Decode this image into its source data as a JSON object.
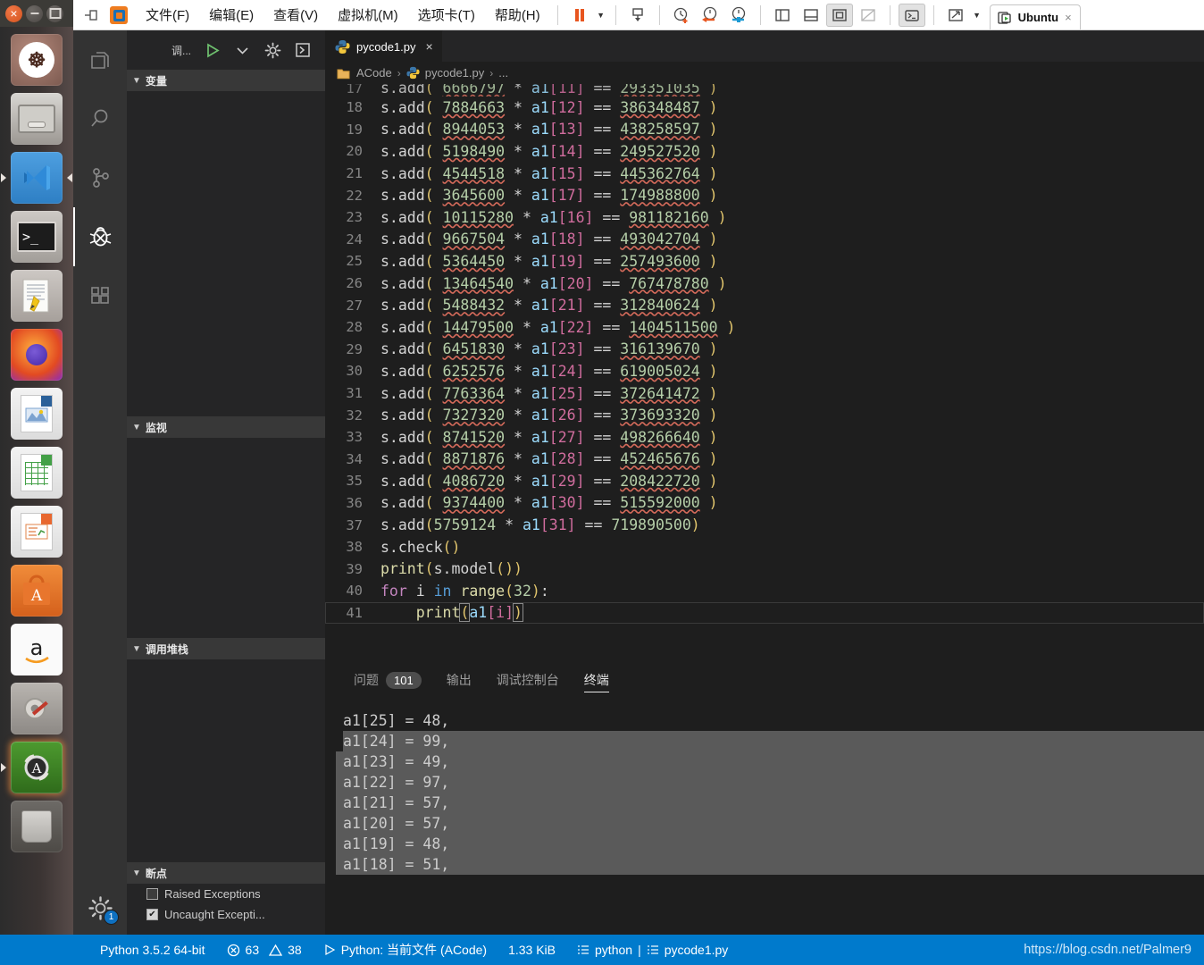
{
  "vmware": {
    "menus": [
      {
        "label": "文件(F)",
        "accel": "F"
      },
      {
        "label": "编辑(E)",
        "accel": "E"
      },
      {
        "label": "查看(V)",
        "accel": "V"
      },
      {
        "label": "虚拟机(M)",
        "accel": "M"
      },
      {
        "label": "选项卡(T)",
        "accel": "T"
      },
      {
        "label": "帮助(H)",
        "accel": "H"
      }
    ],
    "tab_label": "Ubuntu",
    "tab_close": "×",
    "toolbar_icons": [
      "unpin-icon",
      "vmware-logo-icon",
      "suspend-icon",
      "toolbar-dropdown-caret",
      "power-icon",
      "snapshot-take-icon",
      "snapshot-revert-icon",
      "snapshot-manager-icon",
      "sidebar-layout-icon",
      "bottom-layout-icon",
      "fullscreen-icon",
      "unity-mode-icon",
      "console-icon",
      "stretch-icon",
      "stretch-caret-icon"
    ]
  },
  "ubuntu": {
    "window_controls": [
      "close-button",
      "minimize-button",
      "maximize-button"
    ],
    "launcher": [
      {
        "name": "ubuntu-dash",
        "label": "Ubuntu",
        "glyph": "●"
      },
      {
        "name": "files",
        "label": "Files"
      },
      {
        "name": "vscode",
        "label": "Visual Studio Code"
      },
      {
        "name": "terminal",
        "label": "Terminal",
        "glyph": ">_"
      },
      {
        "name": "text-editor",
        "label": "Text Editor"
      },
      {
        "name": "firefox",
        "label": "Firefox"
      },
      {
        "name": "libreoffice-draw",
        "label": "LibreOffice Draw"
      },
      {
        "name": "libreoffice-calc",
        "label": "LibreOffice Calc"
      },
      {
        "name": "libreoffice-impress",
        "label": "LibreOffice Impress"
      },
      {
        "name": "ubuntu-software",
        "label": "Ubuntu Software",
        "glyph": "A"
      },
      {
        "name": "amazon",
        "label": "Amazon",
        "glyph": "a"
      },
      {
        "name": "system-settings",
        "label": "System Settings"
      },
      {
        "name": "software-updater",
        "label": "Software Updater",
        "glyph": "A"
      },
      {
        "name": "trash",
        "label": "Trash"
      }
    ]
  },
  "vscode": {
    "activitybar": [
      {
        "name": "explorer",
        "icon": "files-icon",
        "active": false
      },
      {
        "name": "search",
        "icon": "search-icon",
        "active": false
      },
      {
        "name": "source-control",
        "icon": "branch-icon",
        "active": false
      },
      {
        "name": "debug",
        "icon": "bug-icon",
        "active": true
      },
      {
        "name": "extensions",
        "icon": "extensions-icon",
        "active": false
      }
    ],
    "manage_badge": "1",
    "debug_toolbar": {
      "config_label": "调...",
      "start_icon": "play-icon",
      "dropdown_icon": "chevron-down-icon",
      "gear_icon": "gear-icon",
      "console_icon": "open-debug-console-icon"
    },
    "sidebar_sections": [
      {
        "title": "变量"
      },
      {
        "title": "监视"
      },
      {
        "title": "调用堆栈"
      },
      {
        "title": "断点"
      }
    ],
    "breakpoints": [
      {
        "label": "Raised Exceptions",
        "checked": false
      },
      {
        "label": "Uncaught Excepti...",
        "checked": true
      }
    ],
    "tab": {
      "filename": "pycode1.py",
      "close": "×",
      "icon": "python-file-icon"
    },
    "breadcrumb": {
      "folder": "ACode",
      "file": "pycode1.py",
      "more": "...",
      "separator": "›"
    },
    "code_lines": [
      {
        "num": "17",
        "clipped": true,
        "prefix": "s.add( ",
        "coef": "6666797",
        "var": "a1",
        "idx": "[11]",
        "op": " == ",
        "rhs": "293351035",
        "suffix": " )"
      },
      {
        "num": "18",
        "prefix": "s.add( ",
        "coef": "7884663",
        "var": "a1",
        "idx": "[12]",
        "op": " == ",
        "rhs": "386348487",
        "suffix": " )"
      },
      {
        "num": "19",
        "prefix": "s.add( ",
        "coef": "8944053",
        "var": "a1",
        "idx": "[13]",
        "op": " == ",
        "rhs": "438258597",
        "suffix": " )"
      },
      {
        "num": "20",
        "prefix": "s.add( ",
        "coef": "5198490",
        "var": "a1",
        "idx": "[14]",
        "op": " == ",
        "rhs": "249527520",
        "suffix": " )"
      },
      {
        "num": "21",
        "prefix": "s.add( ",
        "coef": "4544518",
        "var": "a1",
        "idx": "[15]",
        "op": " == ",
        "rhs": "445362764",
        "suffix": " )"
      },
      {
        "num": "22",
        "prefix": "s.add( ",
        "coef": "3645600",
        "var": "a1",
        "idx": "[17]",
        "op": " == ",
        "rhs": "174988800",
        "suffix": " )"
      },
      {
        "num": "23",
        "prefix": "s.add( ",
        "coef": "10115280",
        "var": "a1",
        "idx": "[16]",
        "op": " == ",
        "rhs": "981182160",
        "suffix": " )"
      },
      {
        "num": "24",
        "prefix": "s.add( ",
        "coef": "9667504",
        "var": "a1",
        "idx": "[18]",
        "op": " == ",
        "rhs": "493042704",
        "suffix": " )"
      },
      {
        "num": "25",
        "prefix": "s.add( ",
        "coef": "5364450",
        "var": "a1",
        "idx": "[19]",
        "op": " == ",
        "rhs": "257493600",
        "suffix": " )"
      },
      {
        "num": "26",
        "prefix": "s.add( ",
        "coef": "13464540",
        "var": "a1",
        "idx": "[20]",
        "op": " == ",
        "rhs": "767478780",
        "suffix": " )"
      },
      {
        "num": "27",
        "prefix": "s.add( ",
        "coef": "5488432",
        "var": "a1",
        "idx": "[21]",
        "op": " == ",
        "rhs": "312840624",
        "suffix": " )"
      },
      {
        "num": "28",
        "prefix": "s.add( ",
        "coef": "14479500",
        "var": "a1",
        "idx": "[22]",
        "op": " == ",
        "rhs": "1404511500",
        "suffix": " )"
      },
      {
        "num": "29",
        "prefix": "s.add( ",
        "coef": "6451830",
        "var": "a1",
        "idx": "[23]",
        "op": " == ",
        "rhs": "316139670",
        "suffix": " )"
      },
      {
        "num": "30",
        "prefix": "s.add( ",
        "coef": "6252576",
        "var": "a1",
        "idx": "[24]",
        "op": " == ",
        "rhs": "619005024",
        "suffix": " )"
      },
      {
        "num": "31",
        "prefix": "s.add( ",
        "coef": "7763364",
        "var": "a1",
        "idx": "[25]",
        "op": " == ",
        "rhs": "372641472",
        "suffix": " )"
      },
      {
        "num": "32",
        "prefix": "s.add( ",
        "coef": "7327320",
        "var": "a1",
        "idx": "[26]",
        "op": " == ",
        "rhs": "373693320",
        "suffix": " )"
      },
      {
        "num": "33",
        "prefix": "s.add( ",
        "coef": "8741520",
        "var": "a1",
        "idx": "[27]",
        "op": " == ",
        "rhs": "498266640",
        "suffix": " )"
      },
      {
        "num": "34",
        "prefix": "s.add( ",
        "coef": "8871876",
        "var": "a1",
        "idx": "[28]",
        "op": " == ",
        "rhs": "452465676",
        "suffix": " )"
      },
      {
        "num": "35",
        "prefix": "s.add( ",
        "coef": "4086720",
        "var": "a1",
        "idx": "[29]",
        "op": " == ",
        "rhs": "208422720",
        "suffix": " )"
      },
      {
        "num": "36",
        "prefix": "s.add( ",
        "coef": "9374400",
        "var": "a1",
        "idx": "[30]",
        "op": " == ",
        "rhs": "515592000",
        "suffix": " )"
      },
      {
        "num": "37",
        "prefix": "s.add(",
        "coef": "5759124",
        "var": "a1",
        "idx": "[31]",
        "op": " == ",
        "rhs": "719890500",
        "suffix": ")",
        "nosquiggle": true
      }
    ],
    "code_tail": [
      {
        "num": "38",
        "text": "s.check()"
      },
      {
        "num": "39",
        "text": "print(s.model())"
      },
      {
        "num": "40",
        "text": "for i in range(32):"
      },
      {
        "num": "41",
        "text": "    print(a1[i])"
      }
    ],
    "panel_tabs": [
      {
        "label": "问题",
        "badge": "101",
        "active": false
      },
      {
        "label": "输出",
        "badge": "",
        "active": false
      },
      {
        "label": "调试控制台",
        "badge": "",
        "active": false
      },
      {
        "label": "终端",
        "badge": "",
        "active": true
      }
    ],
    "terminal_lines": [
      {
        "text": "a1[25] = 48,",
        "selected": false
      },
      {
        "text": "a1[24] = 99,",
        "selected": true
      },
      {
        "text": "a1[23] = 49,",
        "selected": true
      },
      {
        "text": "a1[22] = 97,",
        "selected": true
      },
      {
        "text": "a1[21] = 57,",
        "selected": true
      },
      {
        "text": "a1[20] = 57,",
        "selected": true
      },
      {
        "text": "a1[19] = 48,",
        "selected": true
      },
      {
        "text": "a1[18] = 51,",
        "selected": true
      }
    ],
    "statusbar": {
      "python_version": "Python 3.5.2 64-bit",
      "errors": "63",
      "warnings": "38",
      "run_config": "Python: 当前文件 (ACode)",
      "filesize": "1.33 KiB",
      "language": "python",
      "divider": "|",
      "filename": "pycode1.py",
      "watermark": "https://blog.csdn.net/Palmer9",
      "error_icon": "error-circle-icon",
      "warning_icon": "warning-triangle-icon",
      "run_icon": "play-outline-icon",
      "list-icon": "list-icon"
    }
  },
  "colors": {
    "accent": "#007acc",
    "editor_bg": "#1e1e1e",
    "sidebar_bg": "#252526",
    "activitybar_bg": "#333333",
    "number_token": "#b5cea8",
    "index_token": "#d16d9e",
    "paren_token": "#e0c46c",
    "keyword_token": "#c586c0",
    "squiggle": "#d46a5a"
  }
}
